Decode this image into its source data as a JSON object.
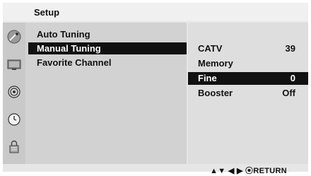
{
  "header": {
    "title": "Setup"
  },
  "menu": {
    "items": [
      {
        "label": "Auto Tuning"
      },
      {
        "label": "Manual Tuning"
      },
      {
        "label": "Favorite Channel"
      }
    ]
  },
  "submenu": {
    "items": [
      {
        "label": "CATV",
        "value": "39"
      },
      {
        "label": "Memory",
        "value": ""
      },
      {
        "label": "Fine",
        "value": "0"
      },
      {
        "label": "Booster",
        "value": "Off"
      }
    ]
  },
  "footer": {
    "hint": "▲▼  ◀ ▶  ⦿RETURN"
  },
  "icons": [
    "satellite-dish-icon",
    "tv-screen-icon",
    "speaker-icon",
    "clock-icon",
    "lock-icon"
  ]
}
